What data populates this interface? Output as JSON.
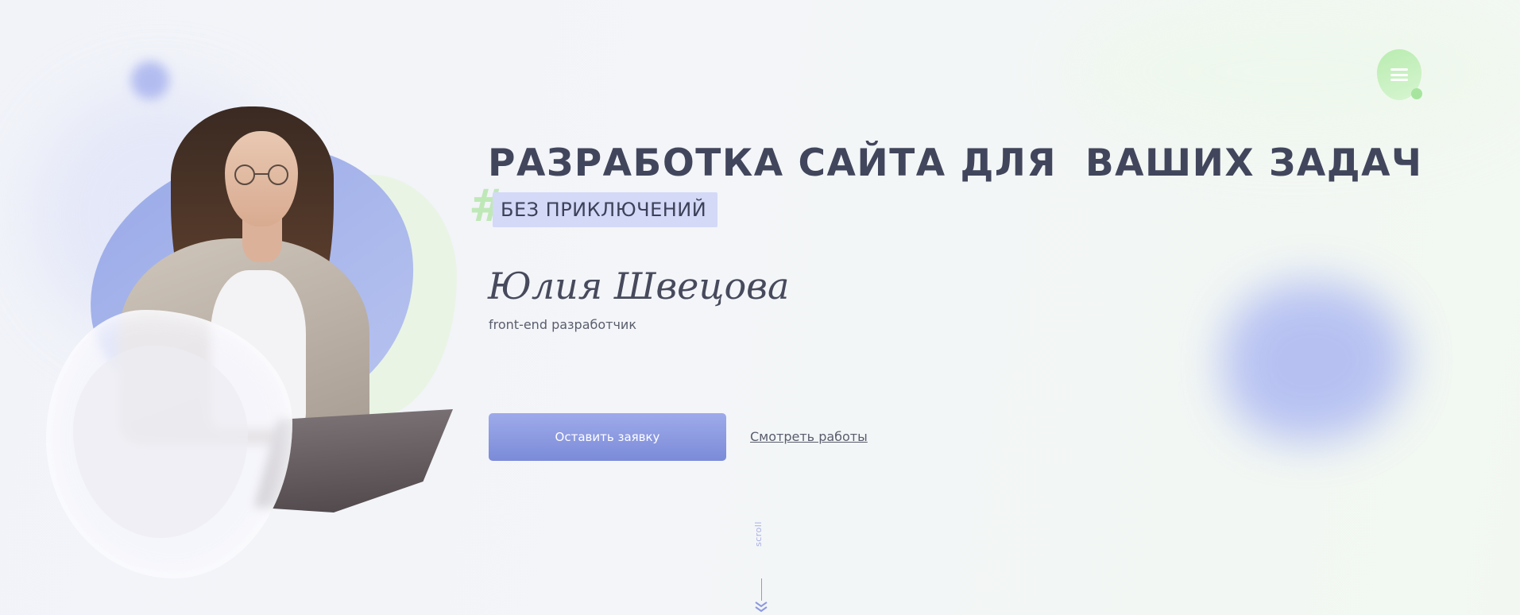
{
  "header": {
    "menu_icon": "hamburger-menu-icon"
  },
  "hero": {
    "headline": "РАЗРАБОТКА САЙТА ДЛЯ  ВАШИХ ЗАДАЧ",
    "hashtag_symbol": "#",
    "tag": "БЕЗ ПРИКЛЮЧЕНИЙ",
    "name": "Юлия Швецова",
    "role": "front-end разработчик",
    "cta_label": "Оставить заявку",
    "works_link": "Смотреть работы",
    "scroll_label": "scroll"
  },
  "colors": {
    "accent_blue": "#7b8bd8",
    "accent_green": "#bfe8b7",
    "text_dark": "#42465c",
    "tag_bg": "#d4d9f8"
  }
}
